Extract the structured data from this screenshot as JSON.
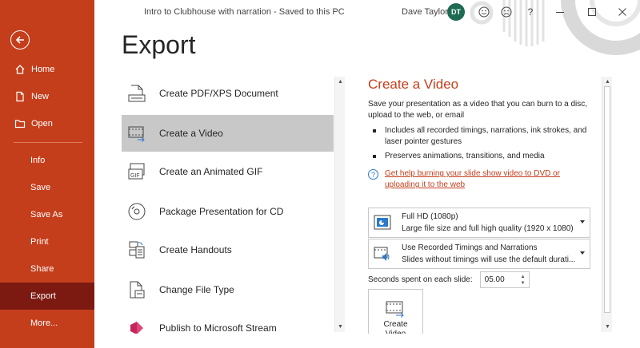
{
  "window": {
    "doc_title": "Intro to Clubhouse with narration  -  Saved to this PC",
    "user_name": "Dave Taylor",
    "user_initials": "DT",
    "help_glyph": "?",
    "icons": [
      "smiley-icon",
      "frown-icon",
      "help-icon",
      "minimize-icon",
      "maximize-icon",
      "close-icon"
    ]
  },
  "sidebar": {
    "back_icon": "back-arrow-icon",
    "items": [
      {
        "label": "Home",
        "icon": "home-icon"
      },
      {
        "label": "New",
        "icon": "new-document-icon"
      },
      {
        "label": "Open",
        "icon": "folder-icon"
      },
      {
        "label": "Info"
      },
      {
        "label": "Save"
      },
      {
        "label": "Save As"
      },
      {
        "label": "Print"
      },
      {
        "label": "Share"
      },
      {
        "label": "Export",
        "active": true
      },
      {
        "label": "More..."
      }
    ]
  },
  "page": {
    "title": "Export"
  },
  "options": [
    {
      "label": "Create PDF/XPS Document",
      "icon": "pdf-document-icon"
    },
    {
      "label": "Create a Video",
      "icon": "video-film-icon",
      "active": true
    },
    {
      "label": "Create an Animated GIF",
      "icon": "gif-icon"
    },
    {
      "label": "Package Presentation for CD",
      "icon": "cd-disc-icon"
    },
    {
      "label": "Create Handouts",
      "icon": "handouts-icon"
    },
    {
      "label": "Change File Type",
      "icon": "change-file-type-icon"
    },
    {
      "label": "Publish to Microsoft Stream",
      "icon": "stream-icon"
    }
  ],
  "detail": {
    "title": "Create a Video",
    "description": "Save your presentation as a video that you can burn to a disc, upload to the web, or email",
    "bullets": [
      "Includes all recorded timings, narrations, ink strokes, and laser pointer gestures",
      "Preserves animations, transitions, and media"
    ],
    "help_link": "Get help burning your slide show video to DVD or uploading it to the web",
    "quality": {
      "title": "Full HD (1080p)",
      "subtitle": "Large file size and full high quality (1920 x 1080)"
    },
    "timings": {
      "title": "Use Recorded Timings and Narrations",
      "subtitle": "Slides without timings will use the default durati..."
    },
    "seconds_label": "Seconds spent on each slide:",
    "seconds_value": "05.00",
    "create_button": "Create\nVideo"
  },
  "colors": {
    "accent": "#c43e1c",
    "sidebar_active": "#7c1a12",
    "option_active": "#c8c8c8",
    "link": "#c43e1c"
  }
}
